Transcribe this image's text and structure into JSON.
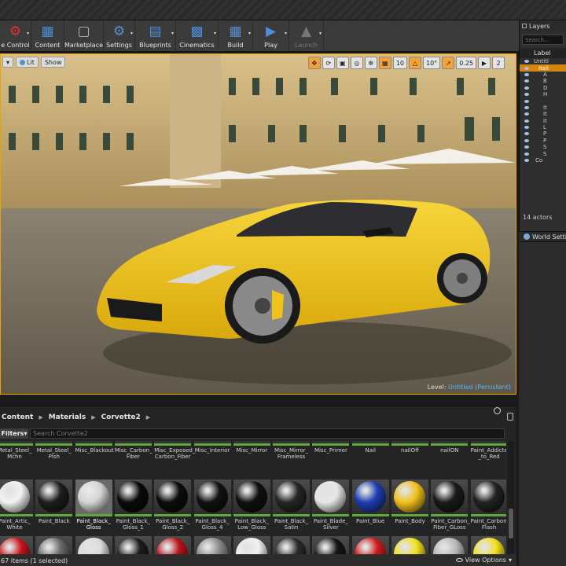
{
  "toolbar": {
    "items": [
      {
        "label": "e Control",
        "icon": "source-control-icon",
        "has_arrow": true
      },
      {
        "label": "Content",
        "icon": "content-browser-icon",
        "has_arrow": false
      },
      {
        "label": "Marketplace",
        "icon": "marketplace-icon",
        "has_arrow": false
      },
      {
        "label": "Settings",
        "icon": "settings-icon",
        "has_arrow": true
      },
      {
        "label": "Blueprints",
        "icon": "blueprints-icon",
        "has_arrow": true
      },
      {
        "label": "Cinematics",
        "icon": "cinematics-icon",
        "has_arrow": true
      },
      {
        "label": "Build",
        "icon": "build-icon",
        "has_arrow": true
      },
      {
        "label": "Play",
        "icon": "play-icon",
        "has_arrow": true
      },
      {
        "label": "Launch",
        "icon": "launch-icon",
        "has_arrow": true,
        "disabled": true
      }
    ]
  },
  "viewport": {
    "left_buttons": [
      "Lit",
      "Show"
    ],
    "grid_size": "10",
    "rotation_snap": "10°",
    "scale_snap": "0.25",
    "camera_speed": "2",
    "level_label": "Level:",
    "level_name": "Untitled (Persistent)",
    "accent": "#e9a400"
  },
  "outliner": {
    "tab": "Layers",
    "search_placeholder": "Search...",
    "column_label": "Label",
    "rows": [
      "Untitl",
      "Itali",
      "A",
      "B",
      "D",
      "H",
      "",
      "It",
      "It",
      "It",
      "L",
      "P",
      "P",
      "S",
      "S",
      "Co"
    ],
    "selected_row": 1,
    "actor_count": "14 actors"
  },
  "world_settings": "World Settin",
  "content_browser": {
    "path": [
      "Content",
      "Materials",
      "Corvette2"
    ],
    "filters_label": "Filters",
    "search_placeholder": "Search Corvette2",
    "status": "67 items (1 selected)",
    "view_options": "View Options",
    "top_row_labels": [
      "Metal_Steel_\nMchn",
      "Metal_Steel_\nPlsh",
      "Misc_Blackout",
      "Misc_Carbon_\nFiber",
      "Misc_Exposed_\nCarbon_Fiber",
      "Misc_Interior",
      "Misc_Mirror",
      "Misc_Mirror_\nFrameless",
      "Misc_Primer",
      "Nail",
      "nailOff",
      "nailON",
      "Paint_Addicted\n_to_Red"
    ],
    "rows": [
      [
        {
          "label": "Paint_Artic_\nWhite",
          "color": "#f2f2f2"
        },
        {
          "label": "Paint_Black",
          "color": "#1e1e1e"
        },
        {
          "label": "Paint_Black_\nGloss",
          "color": "#d4d4d4",
          "selected": true
        },
        {
          "label": "Paint_Black_\nGloss_1",
          "color": "#0a0a0a"
        },
        {
          "label": "Paint_Black_\nGloss_2",
          "color": "#0c0c0c"
        },
        {
          "label": "Paint_Black_\nGloss_4",
          "color": "#121212"
        },
        {
          "label": "Paint_Black_\nLow_Gloss",
          "color": "#101010"
        },
        {
          "label": "Paint_Black_\nSatin",
          "color": "#262626"
        },
        {
          "label": "Paint_Blade_\nSilver",
          "color": "#e6e6e6"
        },
        {
          "label": "Paint_Blue",
          "color": "#1d3fb0"
        },
        {
          "label": "Paint_Body",
          "color": "#f0c21a"
        },
        {
          "label": "Paint_Carbon_\nFiber_GLoss",
          "color": "#1a1a1a"
        },
        {
          "label": "Paint_Carbon_\nFlash",
          "color": "#222222"
        }
      ],
      [
        {
          "label": "",
          "color": "#c8141a"
        },
        {
          "label": "",
          "color": "#6a6a6a"
        },
        {
          "label": "",
          "color": "#dcdcdc"
        },
        {
          "label": "",
          "color": "#1c1c1c"
        },
        {
          "label": "",
          "color": "#b81318"
        },
        {
          "label": "",
          "color": "#8a8a8a"
        },
        {
          "label": "",
          "color": "#f2f2f2"
        },
        {
          "label": "",
          "color": "#2a2a2a"
        },
        {
          "label": "",
          "color": "#141414"
        },
        {
          "label": "",
          "color": "#d01a1a"
        },
        {
          "label": "",
          "color": "#f2e21a"
        },
        {
          "label": "",
          "color": "#b8b8b8"
        },
        {
          "label": "",
          "color": "#f5e11c"
        }
      ]
    ]
  }
}
